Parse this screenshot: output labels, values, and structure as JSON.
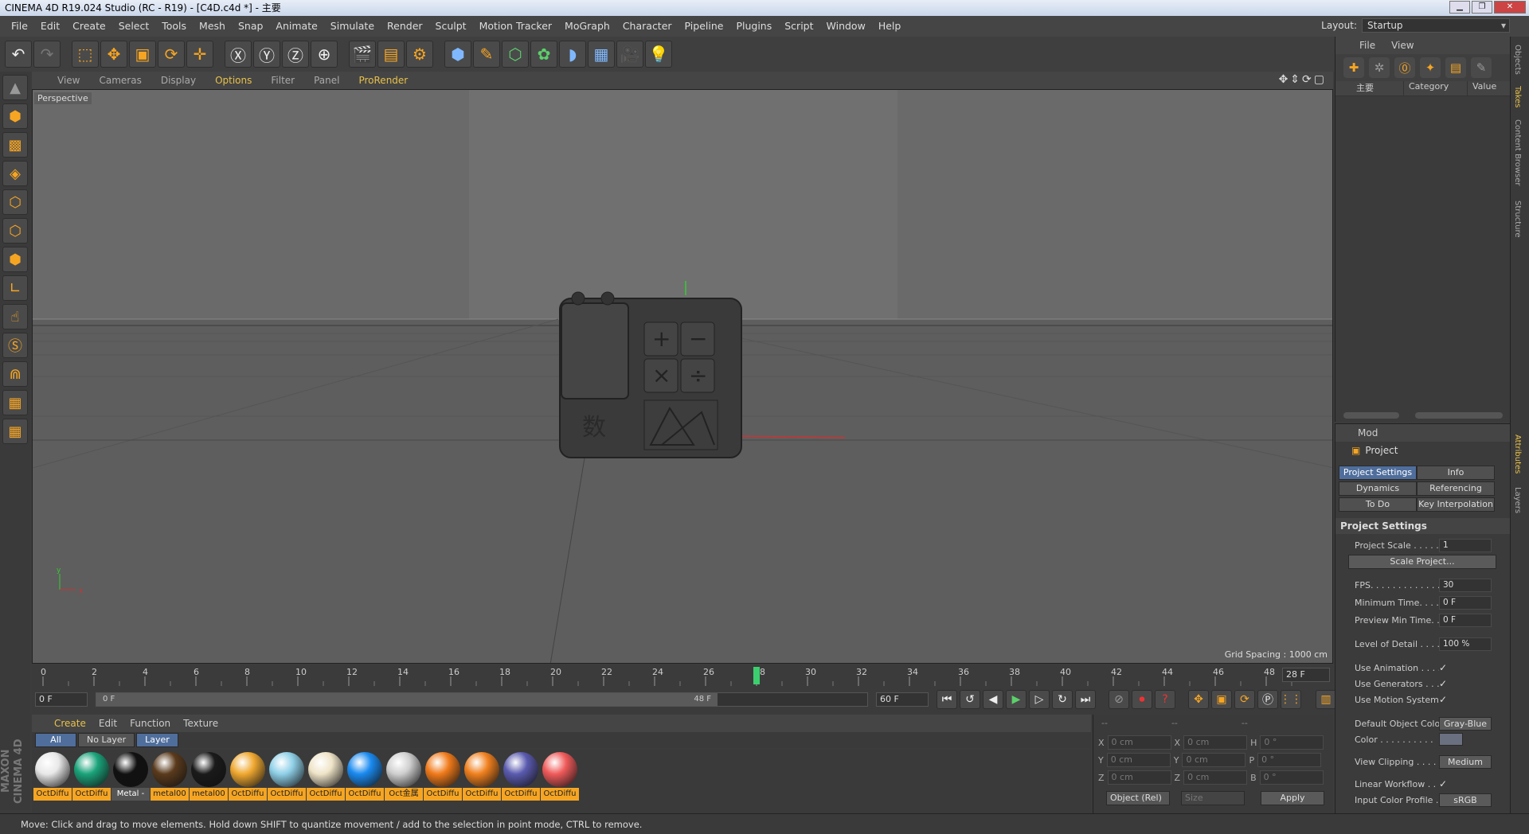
{
  "window": {
    "title": "CINEMA 4D R19.024 Studio (RC - R19) - [C4D.c4d *] - 主要"
  },
  "menu": [
    "File",
    "Edit",
    "Create",
    "Select",
    "Tools",
    "Mesh",
    "Snap",
    "Animate",
    "Simulate",
    "Render",
    "Sculpt",
    "Motion Tracker",
    "MoGraph",
    "Character",
    "Pipeline",
    "Plugins",
    "Script",
    "Window",
    "Help"
  ],
  "layout": {
    "label": "Layout:",
    "value": "Startup"
  },
  "viewport": {
    "menu": [
      "View",
      "Cameras",
      "Display",
      "Options",
      "Filter",
      "Panel",
      "ProRender"
    ],
    "active_menu": "Options",
    "label": "Perspective",
    "grid_spacing": "Grid Spacing : 1000 cm",
    "axis_x": "x",
    "axis_y": "y",
    "tag_glyph": "数"
  },
  "timeline": {
    "ticks": [
      "0",
      "2",
      "4",
      "6",
      "8",
      "10",
      "12",
      "14",
      "16",
      "18",
      "20",
      "22",
      "24",
      "26",
      "28",
      "30",
      "32",
      "34",
      "36",
      "38",
      "40",
      "42",
      "44",
      "46",
      "48"
    ],
    "current_frame_label": "28 F",
    "start": "0 F",
    "range_start": "0 F",
    "range_end": "48 F",
    "end": "60 F",
    "playhead_frame": 28
  },
  "materials": {
    "menu": [
      "Create",
      "Edit",
      "Function",
      "Texture"
    ],
    "tabs": [
      "All",
      "No Layer",
      "Layer"
    ],
    "items": [
      {
        "label": "OctDiffu",
        "color": "#e8e8e8"
      },
      {
        "label": "OctDiffu",
        "color": "#1aa37a"
      },
      {
        "label": "Metal -",
        "color": "#111111"
      },
      {
        "label": "metal00",
        "color": "#5a3a1c"
      },
      {
        "label": "metal00",
        "color": "#1a1a1a"
      },
      {
        "label": "OctDiffu",
        "color": "#f0a830"
      },
      {
        "label": "OctDiffu",
        "color": "#8fd0e8"
      },
      {
        "label": "OctDiffu",
        "color": "#efe4c8"
      },
      {
        "label": "OctDiffu",
        "color": "#1a8af0"
      },
      {
        "label": "Oct金属",
        "color": "#cfcfcf"
      },
      {
        "label": "OctDiffu",
        "color": "#f07a1a"
      },
      {
        "label": "OctDiffu",
        "color": "#f0801e"
      },
      {
        "label": "OctDiffu",
        "color": "#5a5ab0"
      },
      {
        "label": "OctDiffu",
        "color": "#f05a5a"
      }
    ]
  },
  "coords": {
    "header": [
      "--",
      "--",
      "--"
    ],
    "rows": [
      {
        "a": "X",
        "av": "0 cm",
        "b": "X",
        "bv": "0 cm",
        "c": "H",
        "cv": "0 °"
      },
      {
        "a": "Y",
        "av": "0 cm",
        "b": "Y",
        "bv": "0 cm",
        "c": "P",
        "cv": "0 °"
      },
      {
        "a": "Z",
        "av": "0 cm",
        "b": "Z",
        "bv": "0 cm",
        "c": "B",
        "cv": "0 °"
      }
    ],
    "mode": "Object (Rel)",
    "size": "Size",
    "apply": "Apply"
  },
  "objects": {
    "menu": [
      "File",
      "View"
    ],
    "columns": [
      "主要",
      "Category",
      "Value"
    ]
  },
  "attributes": {
    "header": "Mod",
    "title": "Project",
    "tabs": [
      "Project Settings",
      "Info",
      "Dynamics",
      "Referencing",
      "To Do",
      "Key Interpolation"
    ],
    "section": "Project Settings",
    "scale_label": "Project Scale . . . . . .",
    "scale_value": "1",
    "scale_button": "Scale Project...",
    "fps_label": "FPS. . . . . . . . . . . . . .",
    "fps_value": "30",
    "min_label": "Minimum Time. . . . .",
    "min_value": "0 F",
    "pmin_label": "Preview Min Time. . .",
    "pmin_value": "0 F",
    "lod_label": "Level of Detail . . . . .",
    "lod_value": "100 %",
    "anim_label": "Use Animation . . . . .",
    "gen_label": "Use Generators . . . .",
    "motion_label": "Use Motion System",
    "doc_label": "Default Object Color",
    "doc_value": "Gray-Blue",
    "color_label": "Color . . . . . . . . . .",
    "clip_label": "View Clipping . . . . .",
    "clip_value": "Medium",
    "lw_label": "Linear Workflow . . .",
    "icp_label": "Input Color Profile . .",
    "icp_value": "sRGB",
    "check": "✓"
  },
  "side_tabs": [
    "Objects",
    "Takes",
    "Content Browser",
    "Structure",
    "Attributes",
    "Layers"
  ],
  "status": "Move: Click and drag to move elements. Hold down SHIFT to quantize movement / add to the selection in point mode, CTRL to remove.",
  "brand": "MAXON CINEMA 4D"
}
